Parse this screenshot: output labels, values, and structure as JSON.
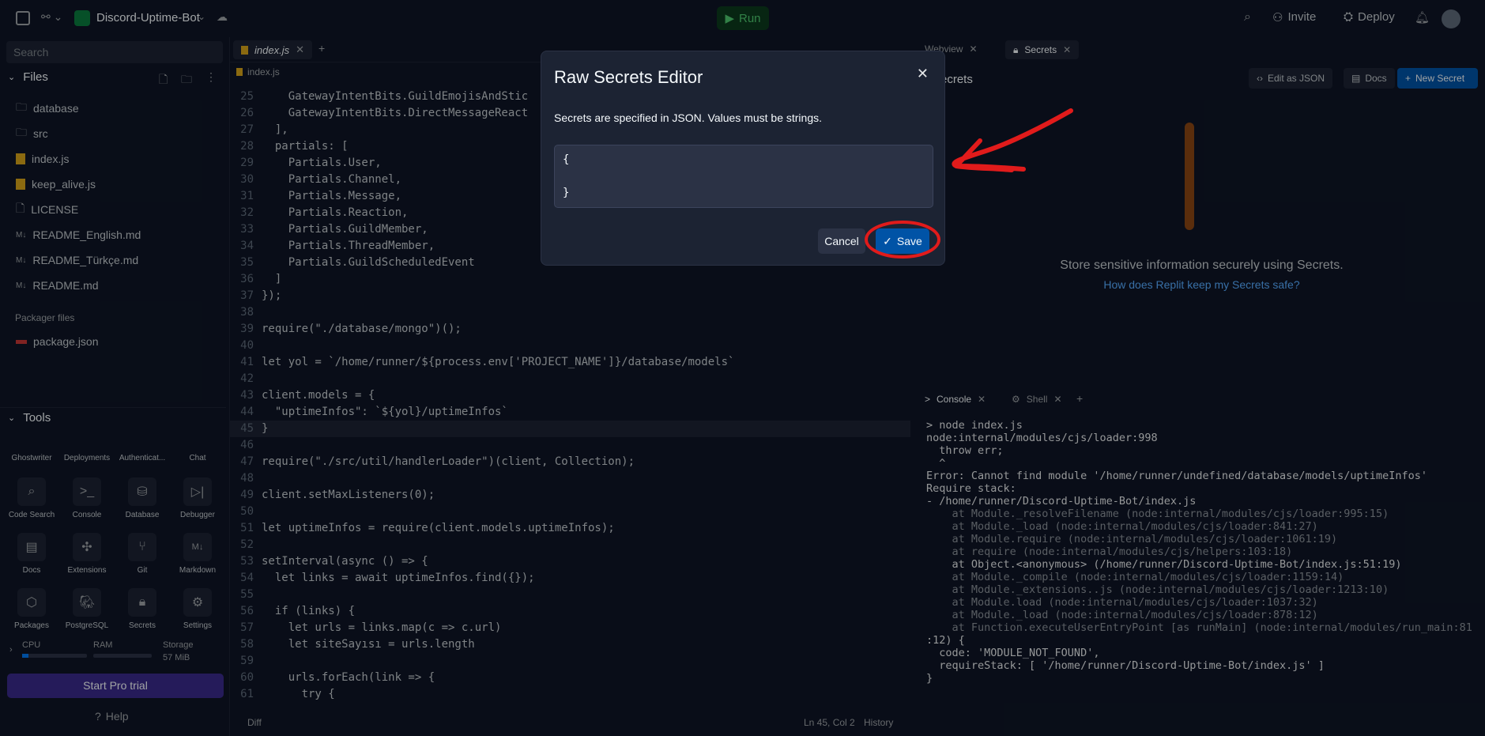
{
  "topbar": {
    "project_name": "Discord-Uptime-Bot",
    "run_label": "Run",
    "invite_label": "Invite",
    "deploy_label": "Deploy"
  },
  "sidebar": {
    "search_placeholder": "Search",
    "files_header": "Files",
    "files": [
      "database",
      "src",
      "index.js",
      "keep_alive.js",
      "LICENSE",
      "README_English.md",
      "README_Türkçe.md",
      "README.md"
    ],
    "packager_header": "Packager files",
    "packager_files": [
      "package.json"
    ],
    "tools_header": "Tools",
    "tools_row0": [
      "Ghostwriter",
      "Deployments",
      "Authenticat...",
      "Chat"
    ],
    "tools": [
      "Code Search",
      "Console",
      "Database",
      "Debugger",
      "Docs",
      "Extensions",
      "Git",
      "Markdown",
      "Packages",
      "PostgreSQL",
      "Secrets",
      "Settings"
    ],
    "cpu_label": "CPU",
    "ram_label": "RAM",
    "storage_label": "Storage",
    "storage_value": "57 MiB",
    "pro_trial": "Start Pro trial",
    "help": "Help"
  },
  "editor": {
    "tab": "index.js",
    "breadcrumb": "index.js",
    "status_pos": "Ln 45, Col 2",
    "history": "History",
    "diff": "Diff",
    "lines": [
      {
        "n": "25",
        "t": "    GatewayIntentBits.GuildEmojisAndStic"
      },
      {
        "n": "26",
        "t": "    GatewayIntentBits.DirectMessageReact"
      },
      {
        "n": "27",
        "t": "  ],"
      },
      {
        "n": "28",
        "t": "  partials: ["
      },
      {
        "n": "29",
        "t": "    Partials.User,"
      },
      {
        "n": "30",
        "t": "    Partials.Channel,"
      },
      {
        "n": "31",
        "t": "    Partials.Message,"
      },
      {
        "n": "32",
        "t": "    Partials.Reaction,"
      },
      {
        "n": "33",
        "t": "    Partials.GuildMember,"
      },
      {
        "n": "34",
        "t": "    Partials.ThreadMember,"
      },
      {
        "n": "35",
        "t": "    Partials.GuildScheduledEvent"
      },
      {
        "n": "36",
        "t": "  ]"
      },
      {
        "n": "37",
        "t": "});"
      },
      {
        "n": "38",
        "t": ""
      },
      {
        "n": "39",
        "t": "require(\"./database/mongo\")();"
      },
      {
        "n": "40",
        "t": ""
      },
      {
        "n": "41",
        "t": "let yol = `/home/runner/${process.env['PROJECT_NAME']}/database/models`"
      },
      {
        "n": "42",
        "t": ""
      },
      {
        "n": "43",
        "t": "client.models = {"
      },
      {
        "n": "44",
        "t": "  \"uptimeInfos\": `${yol}/uptimeInfos`"
      },
      {
        "n": "45",
        "t": "}"
      },
      {
        "n": "46",
        "t": ""
      },
      {
        "n": "47",
        "t": "require(\"./src/util/handlerLoader\")(client, Collection);"
      },
      {
        "n": "48",
        "t": ""
      },
      {
        "n": "49",
        "t": "client.setMaxListeners(0);"
      },
      {
        "n": "50",
        "t": ""
      },
      {
        "n": "51",
        "t": "let uptimeInfos = require(client.models.uptimeInfos);"
      },
      {
        "n": "52",
        "t": ""
      },
      {
        "n": "53",
        "t": "setInterval(async () => {"
      },
      {
        "n": "54",
        "t": "  let links = await uptimeInfos.find({});"
      },
      {
        "n": "55",
        "t": ""
      },
      {
        "n": "56",
        "t": "  if (links) {"
      },
      {
        "n": "57",
        "t": "    let urls = links.map(c => c.url)"
      },
      {
        "n": "58",
        "t": "    let siteSayısı = urls.length"
      },
      {
        "n": "59",
        "t": ""
      },
      {
        "n": "60",
        "t": "    urls.forEach(link => {"
      },
      {
        "n": "61",
        "t": "      try {"
      }
    ]
  },
  "secrets_pane": {
    "tab_webview": "Webview",
    "tab_secrets": "Secrets",
    "title": "Secrets",
    "edit_json": "Edit as JSON",
    "docs": "Docs",
    "new_secret": "New Secret",
    "empty_text": "Store sensitive information securely using Secrets.",
    "help_link": "How does Replit keep my Secrets safe?"
  },
  "console": {
    "tab_console": "Console",
    "tab_shell": "Shell",
    "lines": [
      "> node index.js",
      "node:internal/modules/cjs/loader:998",
      "  throw err;",
      "  ^",
      "",
      "Error: Cannot find module '/home/runner/undefined/database/models/uptimeInfos'",
      "Require stack:",
      "- /home/runner/Discord-Uptime-Bot/index.js",
      "    at Module._resolveFilename (node:internal/modules/cjs/loader:995:15)",
      "    at Module._load (node:internal/modules/cjs/loader:841:27)",
      "    at Module.require (node:internal/modules/cjs/loader:1061:19)",
      "    at require (node:internal/modules/cjs/helpers:103:18)",
      "    at Object.<anonymous> (/home/runner/Discord-Uptime-Bot/index.js:51:19)",
      "    at Module._compile (node:internal/modules/cjs/loader:1159:14)",
      "    at Module._extensions..js (node:internal/modules/cjs/loader:1213:10)",
      "    at Module.load (node:internal/modules/cjs/loader:1037:32)",
      "    at Module._load (node:internal/modules/cjs/loader:878:12)",
      "    at Function.executeUserEntryPoint [as runMain] (node:internal/modules/run_main:81",
      ":12) {",
      "  code: 'MODULE_NOT_FOUND',",
      "  requireStack: [ '/home/runner/Discord-Uptime-Bot/index.js' ]",
      "}"
    ]
  },
  "modal": {
    "title": "Raw Secrets Editor",
    "description": "Secrets are specified in JSON. Values must be strings.",
    "json_value": "{\n\n}",
    "cancel": "Cancel",
    "save": "Save"
  },
  "colors": {
    "annotation": "#e11b1b",
    "save_blue": "#0053a6"
  }
}
